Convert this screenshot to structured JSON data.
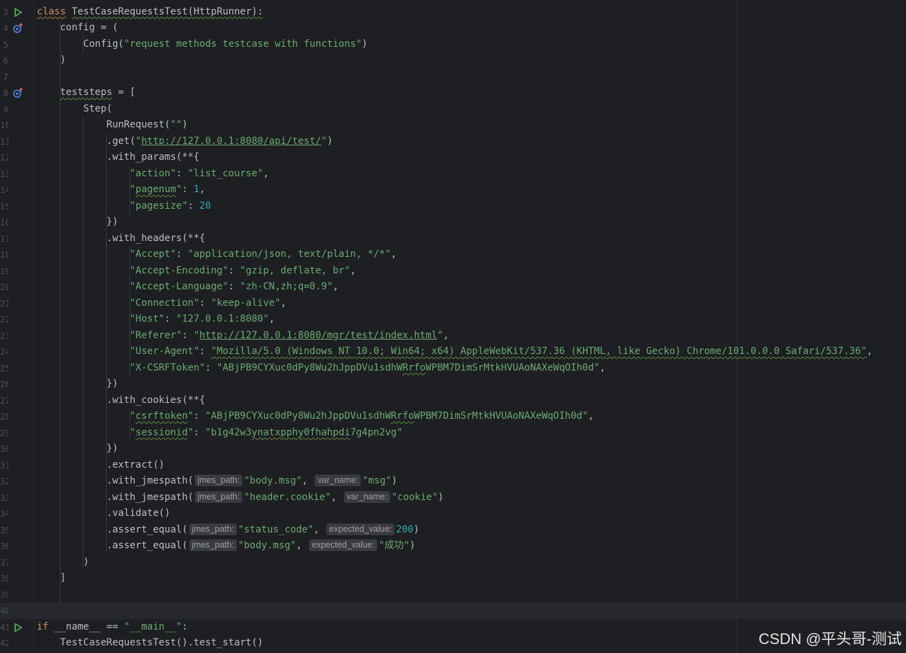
{
  "editor": {
    "lines": [
      {
        "n": "3",
        "icon": "run",
        "tokens": [
          [
            "kw squig-kw",
            "class"
          ],
          [
            "",
            " "
          ],
          [
            "squig",
            "TestCaseRequestsTest"
          ],
          [
            "squig",
            "(HttpRunner):"
          ]
        ]
      },
      {
        "n": "4",
        "icon": "override",
        "tokens": [
          [
            "",
            "    config = ("
          ]
        ]
      },
      {
        "n": "5",
        "tokens": [
          [
            "",
            "        Config("
          ],
          [
            "str",
            "\"request methods testcase with functions\""
          ],
          [
            "",
            ")"
          ]
        ]
      },
      {
        "n": "6",
        "tokens": [
          [
            "",
            "    )"
          ]
        ]
      },
      {
        "n": "7",
        "tokens": []
      },
      {
        "n": "8",
        "icon": "override",
        "tokens": [
          [
            "",
            "    "
          ],
          [
            "squig",
            "teststeps"
          ],
          [
            "",
            " = ["
          ]
        ]
      },
      {
        "n": "9",
        "tokens": [
          [
            "",
            "        Step("
          ]
        ]
      },
      {
        "n": "10",
        "tokens": [
          [
            "",
            "            RunRequest("
          ],
          [
            "str",
            "\"\""
          ],
          [
            "",
            ")"
          ]
        ]
      },
      {
        "n": "11",
        "tokens": [
          [
            "",
            "            .get("
          ],
          [
            "str",
            "\""
          ],
          [
            "link",
            "http://127.0.0.1:8080/api/test/"
          ],
          [
            "str",
            "\""
          ],
          [
            "",
            ")"
          ]
        ]
      },
      {
        "n": "12",
        "tokens": [
          [
            "",
            "            .with_params(**{"
          ]
        ]
      },
      {
        "n": "13",
        "tokens": [
          [
            "",
            "                "
          ],
          [
            "str",
            "\"action\""
          ],
          [
            "",
            ": "
          ],
          [
            "str",
            "\"list_course\""
          ],
          [
            "",
            ","
          ]
        ]
      },
      {
        "n": "14",
        "tokens": [
          [
            "",
            "                "
          ],
          [
            "str",
            "\""
          ],
          [
            "str squig",
            "pagenum"
          ],
          [
            "str",
            "\""
          ],
          [
            "",
            ": "
          ],
          [
            "num",
            "1"
          ],
          [
            "",
            ","
          ]
        ]
      },
      {
        "n": "15",
        "tokens": [
          [
            "",
            "                "
          ],
          [
            "str",
            "\"pagesize\""
          ],
          [
            "",
            ": "
          ],
          [
            "num",
            "20"
          ]
        ]
      },
      {
        "n": "16",
        "tokens": [
          [
            "",
            "            })"
          ]
        ]
      },
      {
        "n": "17",
        "tokens": [
          [
            "",
            "            .with_headers(**{"
          ]
        ]
      },
      {
        "n": "18",
        "tokens": [
          [
            "",
            "                "
          ],
          [
            "str",
            "\"Accept\""
          ],
          [
            "",
            ": "
          ],
          [
            "str",
            "\"application/json, text/plain, */*\""
          ],
          [
            "",
            ","
          ]
        ]
      },
      {
        "n": "19",
        "tokens": [
          [
            "",
            "                "
          ],
          [
            "str",
            "\"Accept-Encoding\""
          ],
          [
            "",
            ": "
          ],
          [
            "str",
            "\"gzip, deflate, br\""
          ],
          [
            "",
            ","
          ]
        ]
      },
      {
        "n": "20",
        "tokens": [
          [
            "",
            "                "
          ],
          [
            "str",
            "\"Accept-Language\""
          ],
          [
            "",
            ": "
          ],
          [
            "str",
            "\"zh-CN,zh;q=0.9\""
          ],
          [
            "",
            ","
          ]
        ]
      },
      {
        "n": "21",
        "tokens": [
          [
            "",
            "                "
          ],
          [
            "str",
            "\"Connection\""
          ],
          [
            "",
            ": "
          ],
          [
            "str",
            "\"keep-alive\""
          ],
          [
            "",
            ","
          ]
        ]
      },
      {
        "n": "22",
        "tokens": [
          [
            "",
            "                "
          ],
          [
            "str",
            "\"Host\""
          ],
          [
            "",
            ": "
          ],
          [
            "str",
            "\"127.0.0.1:8080\""
          ],
          [
            "",
            ","
          ]
        ]
      },
      {
        "n": "23",
        "tokens": [
          [
            "",
            "                "
          ],
          [
            "str",
            "\"Referer\""
          ],
          [
            "",
            ": "
          ],
          [
            "str",
            "\""
          ],
          [
            "link",
            "http://127.0.0.1:8080/mgr/test/index.html"
          ],
          [
            "str",
            "\""
          ],
          [
            "",
            ","
          ]
        ]
      },
      {
        "n": "24",
        "tokens": [
          [
            "",
            "                "
          ],
          [
            "str",
            "\"User-Agent\""
          ],
          [
            "",
            ": "
          ],
          [
            "str squig",
            "\"Mozilla/5.0 (Windows NT 10.0; Win64; x64) AppleWebKit/537.36 (KHTML, like Gecko) Chrome/101.0.0.0 Safari/537.36\""
          ],
          [
            "",
            ","
          ]
        ]
      },
      {
        "n": "25",
        "tokens": [
          [
            "",
            "                "
          ],
          [
            "str",
            "\"X-CSRFToken\""
          ],
          [
            "",
            ": "
          ],
          [
            "str",
            "\"ABjPB9CYXuc0dPy8Wu2hJppDVu1sdhW"
          ],
          [
            "str squig",
            "Rrfo"
          ],
          [
            "str",
            "WPBM7DimSrMtkHVUAoNAXeWqOIh0d\""
          ],
          [
            "",
            ","
          ]
        ]
      },
      {
        "n": "26",
        "tokens": [
          [
            "",
            "            })"
          ]
        ]
      },
      {
        "n": "27",
        "tokens": [
          [
            "",
            "            .with_cookies(**{"
          ]
        ]
      },
      {
        "n": "28",
        "tokens": [
          [
            "",
            "                "
          ],
          [
            "str",
            "\""
          ],
          [
            "str squig",
            "csrftoken"
          ],
          [
            "str",
            "\""
          ],
          [
            "",
            ": "
          ],
          [
            "str",
            "\"ABjPB9CYXuc0dPy8Wu2hJppDVu1sdhW"
          ],
          [
            "str squig",
            "Rrfo"
          ],
          [
            "str",
            "WPBM7DimSrMtkHVUAoNAXeWqOIh0d\""
          ],
          [
            "",
            ","
          ]
        ]
      },
      {
        "n": "29",
        "tokens": [
          [
            "",
            "                "
          ],
          [
            "str",
            "\""
          ],
          [
            "str squig",
            "sessionid"
          ],
          [
            "str",
            "\""
          ],
          [
            "",
            ": "
          ],
          [
            "str",
            "\"b1g42w3"
          ],
          [
            "str squig",
            "ynatxpphy0fhahpdi"
          ],
          [
            "str",
            "7g4pn2vg\""
          ]
        ]
      },
      {
        "n": "30",
        "tokens": [
          [
            "",
            "            })"
          ]
        ]
      },
      {
        "n": "31",
        "tokens": [
          [
            "",
            "            .extract()"
          ]
        ]
      },
      {
        "n": "32",
        "tokens": [
          [
            "",
            "            .with_jmespath("
          ],
          [
            "hint",
            "jmes_path:"
          ],
          [
            "str",
            "\"body.msg\""
          ],
          [
            "",
            ", "
          ],
          [
            "hint",
            "var_name:"
          ],
          [
            "str",
            "\"msg\""
          ],
          [
            "",
            ")"
          ]
        ]
      },
      {
        "n": "33",
        "tokens": [
          [
            "",
            "            .with_jmespath("
          ],
          [
            "hint",
            "jmes_path:"
          ],
          [
            "str",
            "\"header.cookie\""
          ],
          [
            "",
            ", "
          ],
          [
            "hint",
            "var_name:"
          ],
          [
            "str",
            "\"cookie\""
          ],
          [
            "",
            ")"
          ]
        ]
      },
      {
        "n": "34",
        "tokens": [
          [
            "",
            "            .validate()"
          ]
        ]
      },
      {
        "n": "35",
        "tokens": [
          [
            "",
            "            .assert_equal("
          ],
          [
            "hint",
            "jmes_path:"
          ],
          [
            "str",
            "\"status_code\""
          ],
          [
            "",
            ", "
          ],
          [
            "hint",
            "expected_value:"
          ],
          [
            "num",
            "200"
          ],
          [
            "",
            ")"
          ]
        ]
      },
      {
        "n": "36",
        "tokens": [
          [
            "",
            "            .assert_equal("
          ],
          [
            "hint",
            "jmes_path:"
          ],
          [
            "str",
            "\"body.msg\""
          ],
          [
            "",
            ", "
          ],
          [
            "hint",
            "expected_value:"
          ],
          [
            "str",
            "\"成功\""
          ],
          [
            "",
            ")"
          ]
        ]
      },
      {
        "n": "37",
        "tokens": [
          [
            "",
            "        )"
          ]
        ]
      },
      {
        "n": "38",
        "tokens": [
          [
            "",
            "    ]"
          ]
        ]
      },
      {
        "n": "39",
        "tokens": []
      },
      {
        "n": "40",
        "current": true,
        "tokens": []
      },
      {
        "n": "41",
        "icon": "run",
        "tokens": [
          [
            "kw",
            "if"
          ],
          [
            "",
            " __name__ == "
          ],
          [
            "str",
            "\"__main__\""
          ],
          [
            "",
            ":"
          ]
        ]
      },
      {
        "n": "42",
        "tokens": [
          [
            "",
            "    TestCaseRequestsTest().test_start()"
          ]
        ]
      }
    ]
  },
  "colors": {
    "background": "#1e1f22",
    "keyword": "#cf8e6d",
    "string": "#6aab73",
    "number": "#2aacb8",
    "run_icon": "#5fb865",
    "override_icon": "#548af7"
  },
  "watermark": "CSDN @平头哥-测试"
}
